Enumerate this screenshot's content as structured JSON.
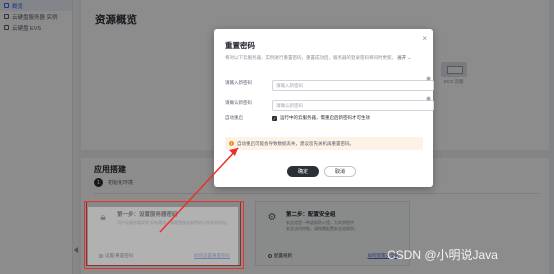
{
  "sidebar": {
    "items": [
      {
        "label": "概览",
        "active": true
      },
      {
        "label": "云硬盘服务器 实例",
        "active": false
      },
      {
        "label": "云硬盘 EVS",
        "active": false
      }
    ]
  },
  "page": {
    "title": "资源概览",
    "ecs_label": "ECS 云服"
  },
  "setup": {
    "title": "应用搭建",
    "step_number": "1",
    "step_label": "初始化环境",
    "task1": {
      "title": "第一步：设置服务器密码",
      "desc": "用户云服务器实例 如有需求，请重置服务器密码以完成初始化。",
      "desc2": "",
      "action": "设置/重置密码",
      "link": "如何设置重置密码"
    },
    "task2": {
      "title": "第二步：配置安全组",
      "desc": "安全组是一种虚拟防火墙，为实例提供",
      "desc2": "安全访问控制，请按需配置安全组规则。",
      "action": "配置规则",
      "link": "如何配置安全组"
    }
  },
  "dialog": {
    "title": "重置密码",
    "close": "×",
    "subtitle": "将对以下云服务器、实例进行重置密码，重置成功后，服务器的登录密码将同时更新。",
    "subtitle_more": "展开 ⌄",
    "new_pw_label": "请输入新密码",
    "new_pw_placeholder": "请输入新密码",
    "confirm_pw_label": "请确认新密码",
    "confirm_pw_placeholder": "请确认新密码",
    "auto_restart_label": "自动重启",
    "auto_restart_text": "运行中的云服务器，需重启后新密码才可生效",
    "warning": "自动重启可能会导致数据丢失，建议您先关机再重置密码。",
    "ok": "确定",
    "cancel": "取消"
  },
  "watermark": "CSDN @小明说Java",
  "colors": {
    "annotation_red": "#e8322b",
    "primary_dark": "#2b2f36",
    "warning_orange": "#f08f19"
  }
}
